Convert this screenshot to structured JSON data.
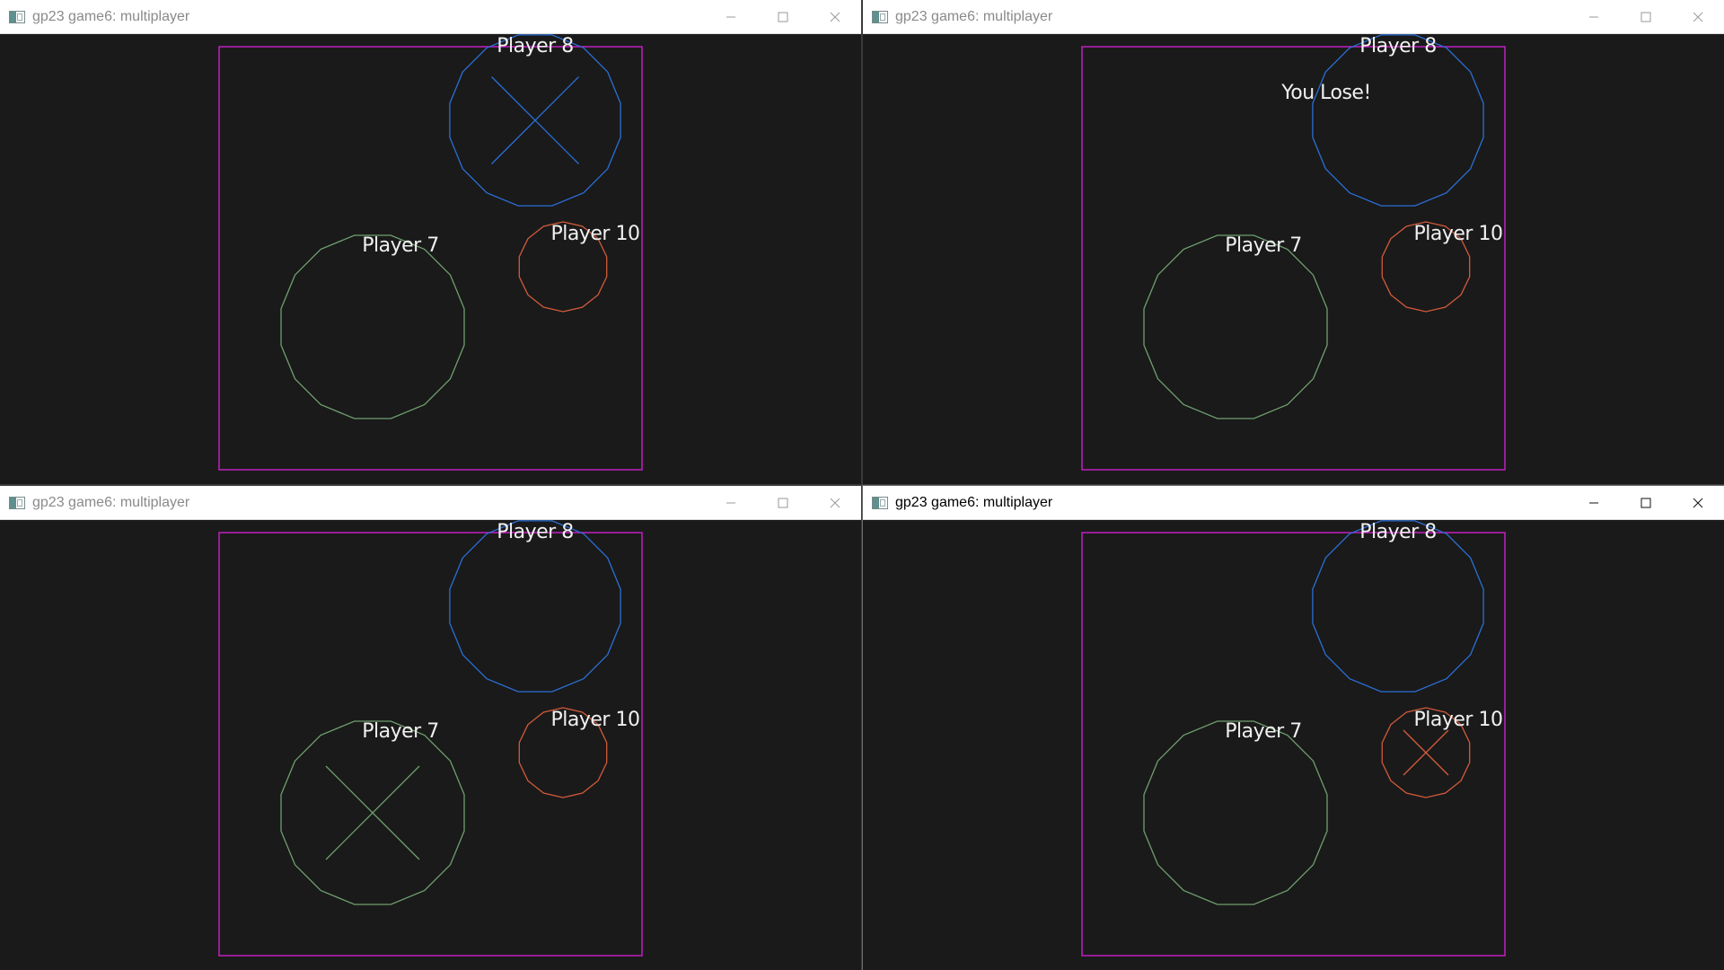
{
  "colors": {
    "background": "#1a1a1a",
    "arena_border": "#c020c0",
    "player8": "#2a6fd6",
    "player7": "#6f9f6f",
    "player10": "#d25a3a",
    "label": "#f0f0f0"
  },
  "windows": [
    {
      "title": "gp23 game6: multiplayer",
      "active": false,
      "labels": {
        "p8": "Player 8",
        "p7": "Player 7",
        "p10": "Player 10"
      },
      "message": "",
      "marked_player": "p8"
    },
    {
      "title": "gp23 game6: multiplayer",
      "active": false,
      "labels": {
        "p8": "Player 8",
        "p7": "Player 7",
        "p10": "Player 10"
      },
      "message": "You Lose!",
      "marked_player": ""
    },
    {
      "title": "gp23 game6: multiplayer",
      "active": false,
      "labels": {
        "p8": "Player 8",
        "p7": "Player 7",
        "p10": "Player 10"
      },
      "message": "",
      "marked_player": "p7"
    },
    {
      "title": "gp23 game6: multiplayer",
      "active": true,
      "labels": {
        "p8": "Player 8",
        "p7": "Player 7",
        "p10": "Player 10"
      },
      "message": "",
      "marked_player": "p10"
    }
  ],
  "controls": {
    "minimize_icon": "minimize-icon",
    "maximize_icon": "maximize-icon",
    "close_icon": "close-icon"
  }
}
